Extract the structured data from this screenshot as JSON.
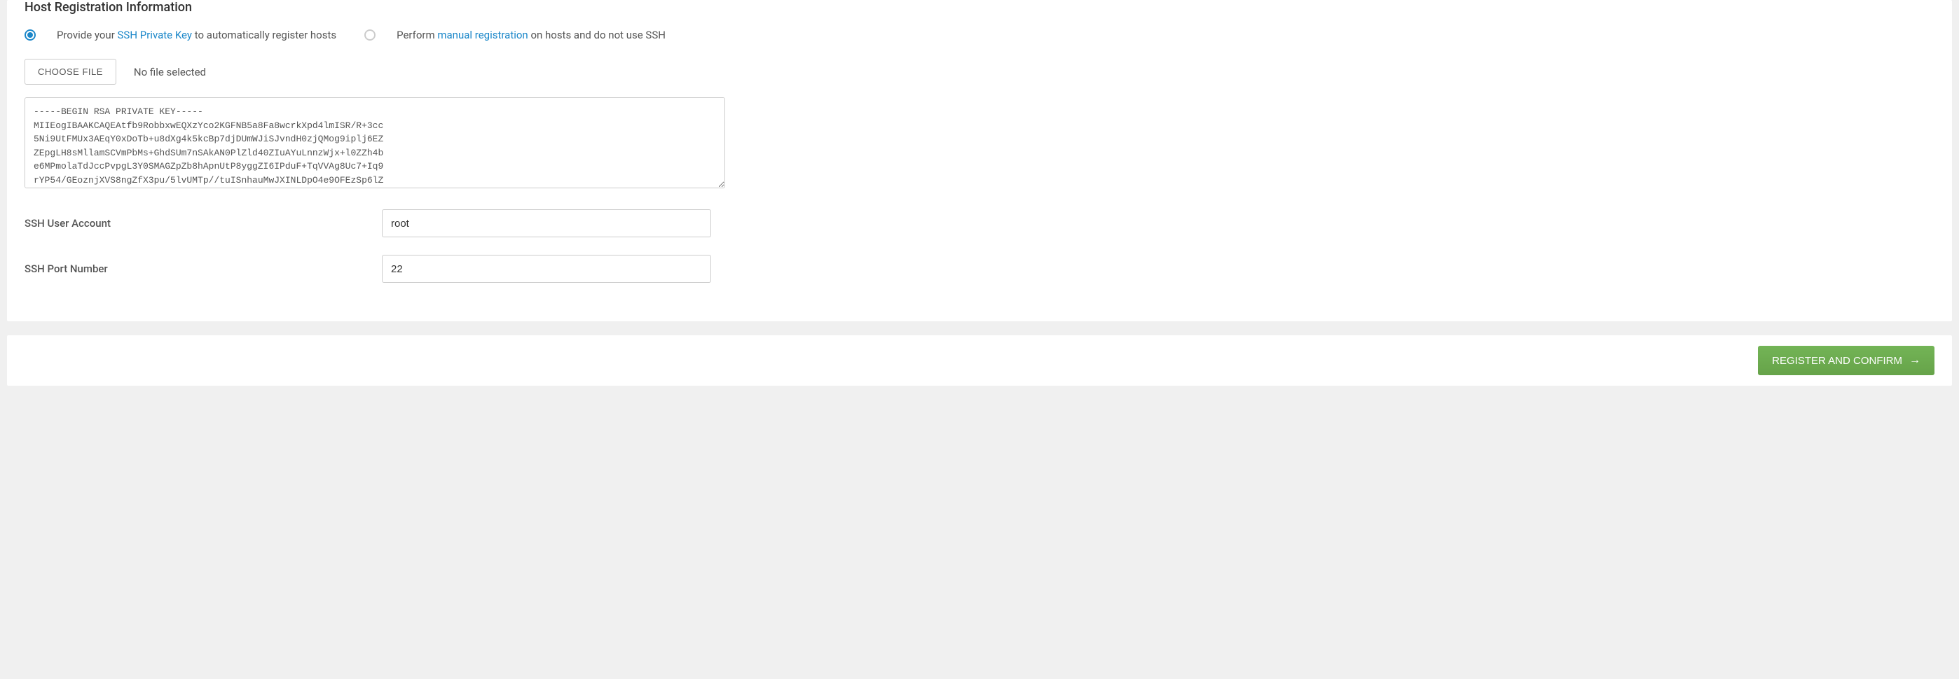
{
  "section": {
    "title": "Host Registration Information"
  },
  "radios": {
    "option_ssh": {
      "prefix": "Provide your ",
      "link": "SSH Private Key",
      "suffix": " to automatically register hosts",
      "checked": true
    },
    "option_manual": {
      "prefix": "Perform ",
      "link": "manual registration",
      "suffix": " on hosts and do not use SSH",
      "checked": false
    }
  },
  "file": {
    "button_label": "CHOOSE FILE",
    "status": "No file selected"
  },
  "ssh_key": "-----BEGIN RSA PRIVATE KEY-----\nMIIEogIBAAKCAQEAtfb9RobbxwEQXzYco2KGFNB5a8Fa8wcrkXpd4lmISR/R+3cc\n5Ni9UtFMUx3AEqY0xDoTb+u8dXg4k5kcBp7djDUmWJiSJvndH0zjQMog9iplj6EZ\nZEpgLH8sMllamSCVmPbMs+GhdSUm7nSAkAN0PlZld40ZIuAYuLnnzWjx+l0ZZh4b\ne6MPmolaTdJccPvpgL3Y0SMAGZpZb8hApnUtP8yggZI6IPduF+TqVVAg8Uc7+Iq9\nrYP54/GEoznjXVS8ngZfX3pu/5lvUMTp//tuISnhauMwJXINLDpO4e9OFEzSp6lZ",
  "fields": {
    "ssh_user": {
      "label": "SSH User Account",
      "value": "root"
    },
    "ssh_port": {
      "label": "SSH Port Number",
      "value": "22"
    }
  },
  "footer": {
    "register_label": "REGISTER AND CONFIRM"
  }
}
